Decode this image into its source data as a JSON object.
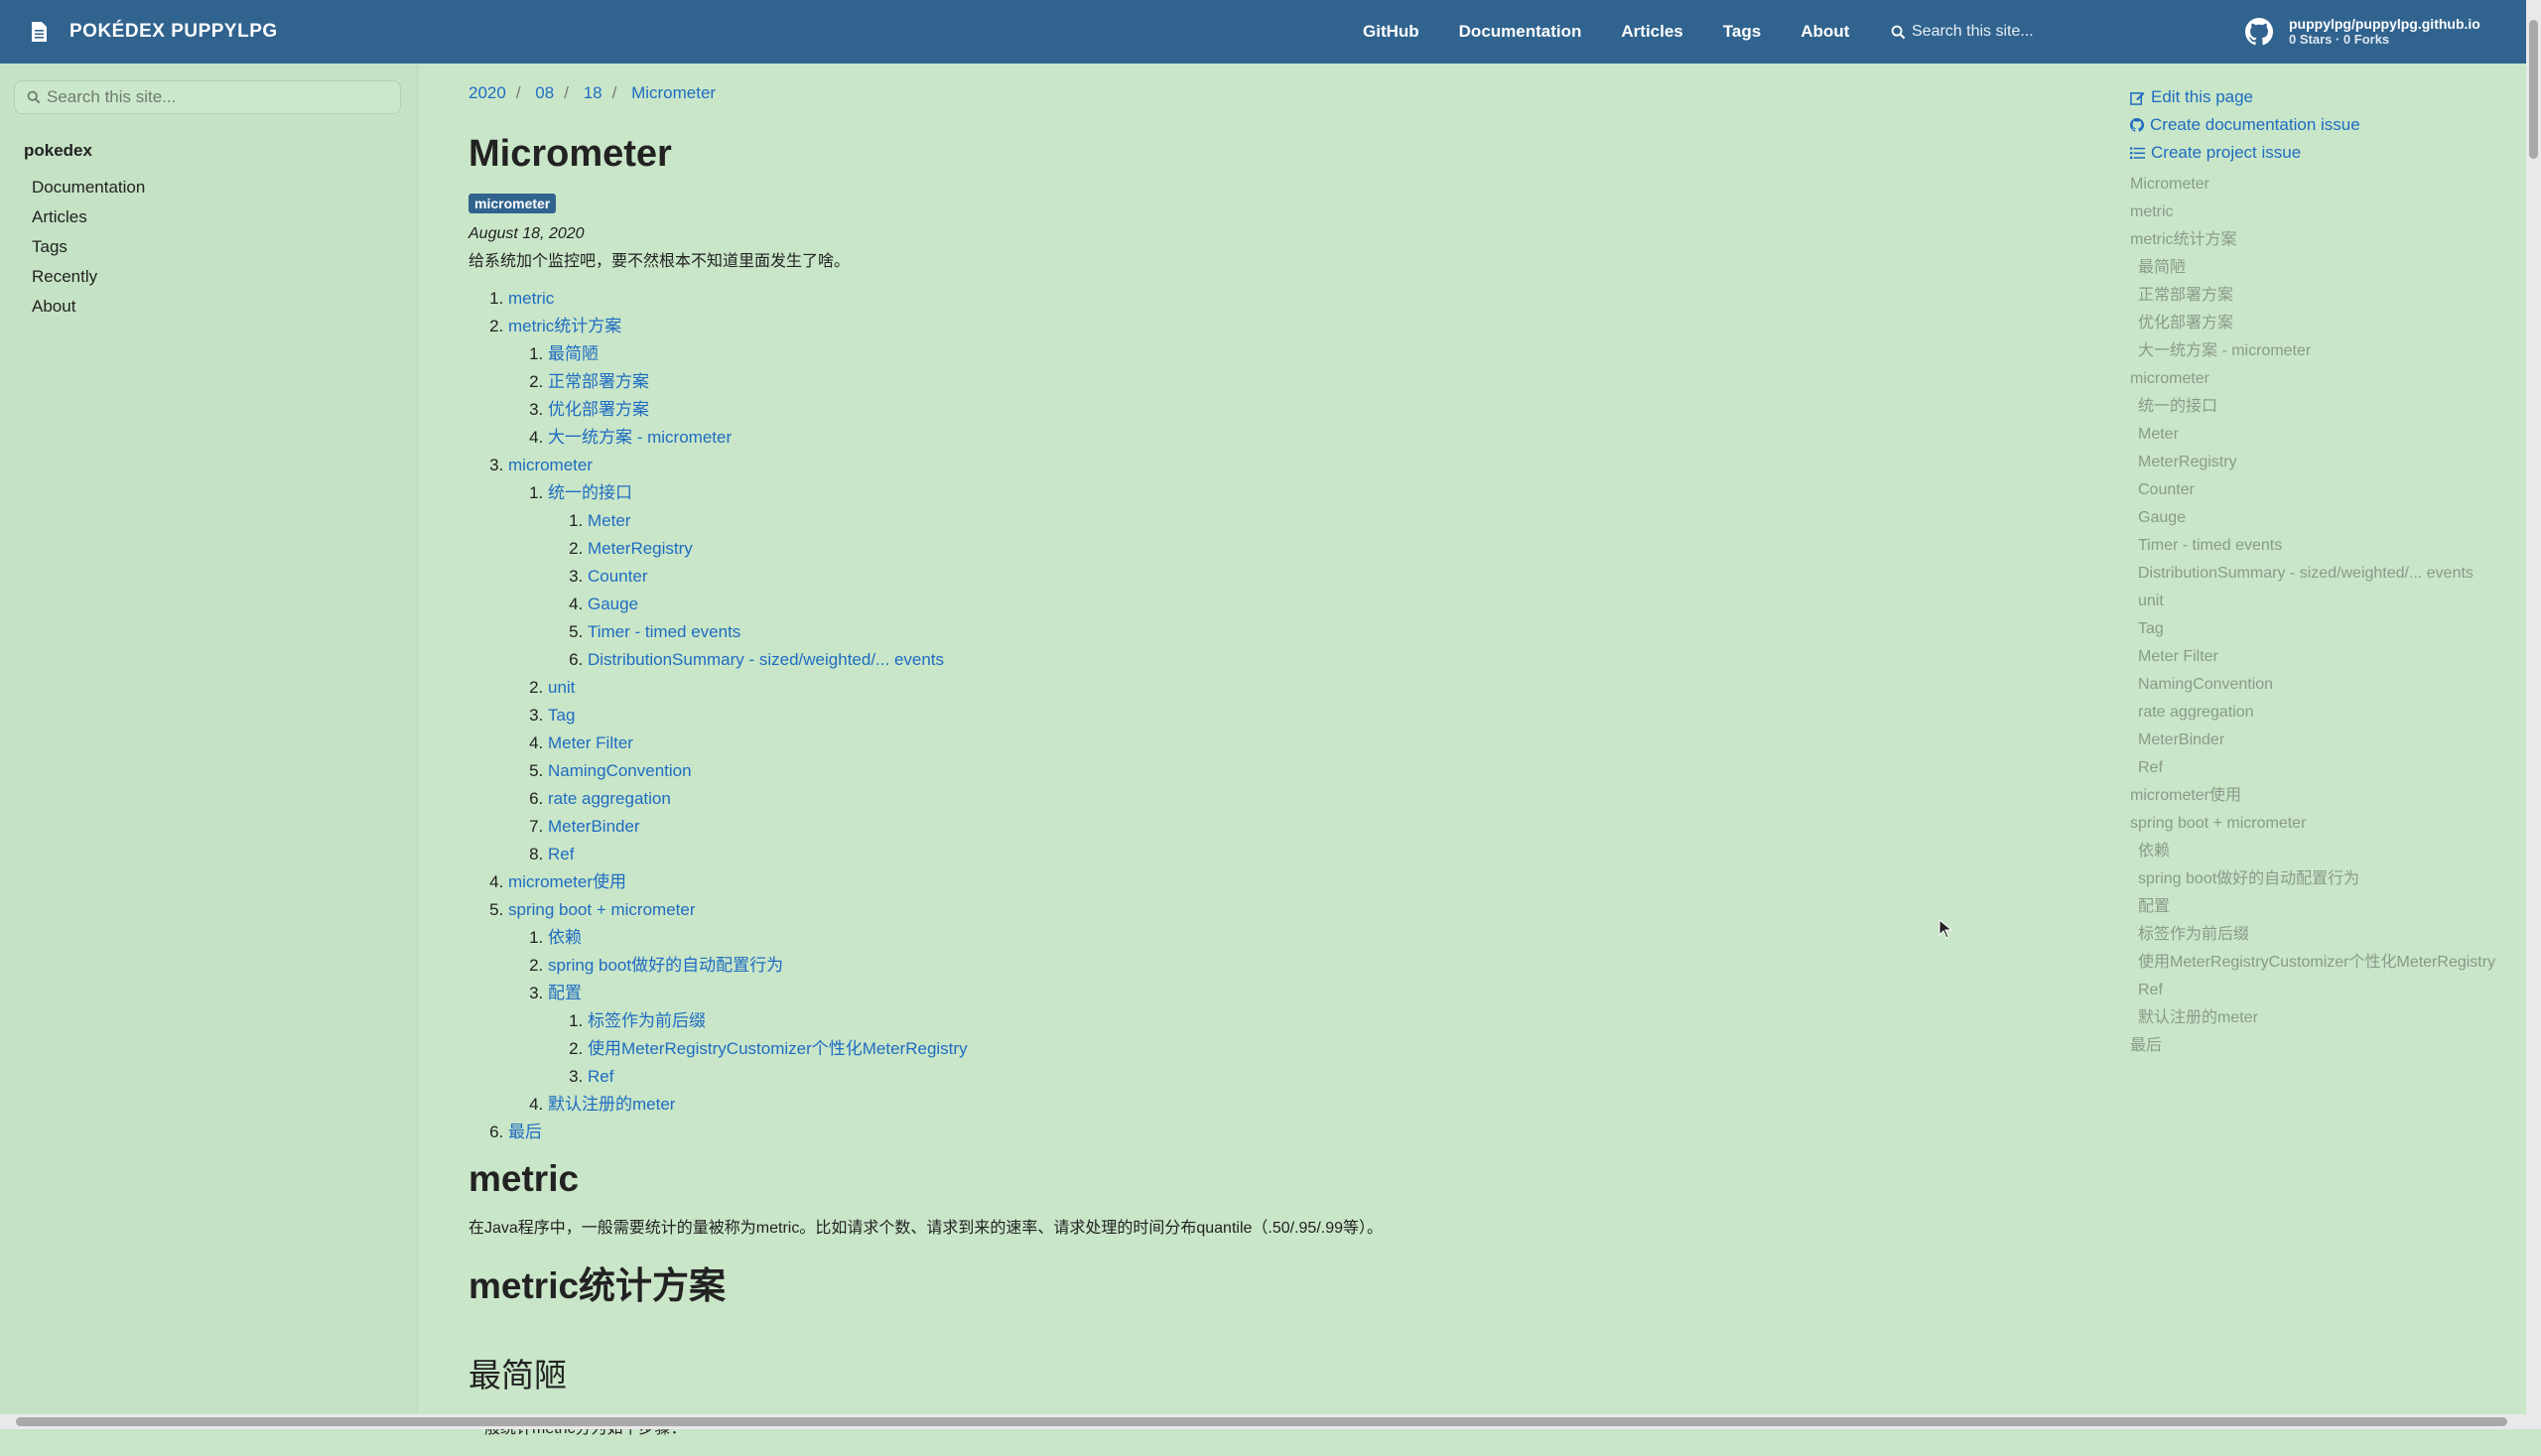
{
  "navbar": {
    "brand": "POKÉDEX PUPPYLPG",
    "links": [
      "GitHub",
      "Documentation",
      "Articles",
      "Tags",
      "About"
    ],
    "search_placeholder": "Search this site...",
    "repo": "puppylpg/puppylpg.github.io",
    "repo_stats": "0 Stars · 0 Forks",
    "color": "#30638e"
  },
  "sidebar": {
    "search_placeholder": "Search this site...",
    "root": "pokedex",
    "items": [
      "Documentation",
      "Articles",
      "Tags",
      "Recently",
      "About"
    ]
  },
  "breadcrumb": [
    "2020",
    "08",
    "18",
    "Micrometer"
  ],
  "page": {
    "title": "Micrometer",
    "tag": "micrometer",
    "date": "August 18, 2020",
    "lead": "给系统加个监控吧，要不然根本不知道里面发生了啥。"
  },
  "toc": [
    {
      "label": "metric"
    },
    {
      "label": "metric统计方案",
      "children": [
        {
          "label": "最简陋"
        },
        {
          "label": "正常部署方案"
        },
        {
          "label": "优化部署方案"
        },
        {
          "label": "大一统方案 - micrometer"
        }
      ]
    },
    {
      "label": "micrometer",
      "children": [
        {
          "label": "统一的接口",
          "children": [
            {
              "label": "Meter"
            },
            {
              "label": "MeterRegistry"
            },
            {
              "label": "Counter"
            },
            {
              "label": "Gauge"
            },
            {
              "label": "Timer - timed events"
            },
            {
              "label": "DistributionSummary - sized/weighted/... events"
            }
          ]
        },
        {
          "label": "unit"
        },
        {
          "label": "Tag"
        },
        {
          "label": "Meter Filter"
        },
        {
          "label": "NamingConvention"
        },
        {
          "label": "rate aggregation"
        },
        {
          "label": "MeterBinder"
        },
        {
          "label": "Ref"
        }
      ]
    },
    {
      "label": "micrometer使用"
    },
    {
      "label": "spring boot + micrometer",
      "children": [
        {
          "label": "依赖"
        },
        {
          "label": "spring boot做好的自动配置行为"
        },
        {
          "label": "配置",
          "children": [
            {
              "label": "标签作为前后缀"
            },
            {
              "label": "使用MeterRegistryCustomizer个性化MeterRegistry"
            },
            {
              "label": "Ref"
            }
          ]
        },
        {
          "label": "默认注册的meter"
        }
      ]
    },
    {
      "label": "最后"
    }
  ],
  "sections": {
    "metric_heading": "metric",
    "metric_text": "在Java程序中，一般需要统计的量被称为metric。比如请求个数、请求到来的速率、请求处理的时间分布quantile（.50/.95/.99等）。",
    "scheme_heading": "metric统计方案",
    "simplest_heading": "最简陋",
    "simplest_text": "一般统计metric分为如下步骤："
  },
  "right_toc": {
    "actions": [
      "Edit this page",
      "Create documentation issue",
      "Create project issue"
    ],
    "items": [
      {
        "label": "Micrometer",
        "level": 1
      },
      {
        "label": "metric",
        "level": 1
      },
      {
        "label": "metric统计方案",
        "level": 1
      },
      {
        "label": "最简陋",
        "level": 2
      },
      {
        "label": "正常部署方案",
        "level": 2
      },
      {
        "label": "优化部署方案",
        "level": 2
      },
      {
        "label": "大一统方案 - micrometer",
        "level": 2
      },
      {
        "label": "micrometer",
        "level": 1
      },
      {
        "label": "统一的接口",
        "level": 2
      },
      {
        "label": "Meter",
        "level": 2
      },
      {
        "label": "MeterRegistry",
        "level": 2
      },
      {
        "label": "Counter",
        "level": 2
      },
      {
        "label": "Gauge",
        "level": 2
      },
      {
        "label": "Timer - timed events",
        "level": 2
      },
      {
        "label": "DistributionSummary - sized/weighted/... events",
        "level": 2
      },
      {
        "label": "unit",
        "level": 2
      },
      {
        "label": "Tag",
        "level": 2
      },
      {
        "label": "Meter Filter",
        "level": 2
      },
      {
        "label": "NamingConvention",
        "level": 2
      },
      {
        "label": "rate aggregation",
        "level": 2
      },
      {
        "label": "MeterBinder",
        "level": 2
      },
      {
        "label": "Ref",
        "level": 2
      },
      {
        "label": "micrometer使用",
        "level": 1
      },
      {
        "label": "spring boot + micrometer",
        "level": 1
      },
      {
        "label": "依赖",
        "level": 2
      },
      {
        "label": "spring boot做好的自动配置行为",
        "level": 2
      },
      {
        "label": "配置",
        "level": 2
      },
      {
        "label": "标签作为前后缀",
        "level": 2
      },
      {
        "label": "使用MeterRegistryCustomizer个性化MeterRegistry",
        "level": 2
      },
      {
        "label": "Ref",
        "level": 2
      },
      {
        "label": "默认注册的meter",
        "level": 2
      },
      {
        "label": "最后",
        "level": 1
      }
    ]
  }
}
